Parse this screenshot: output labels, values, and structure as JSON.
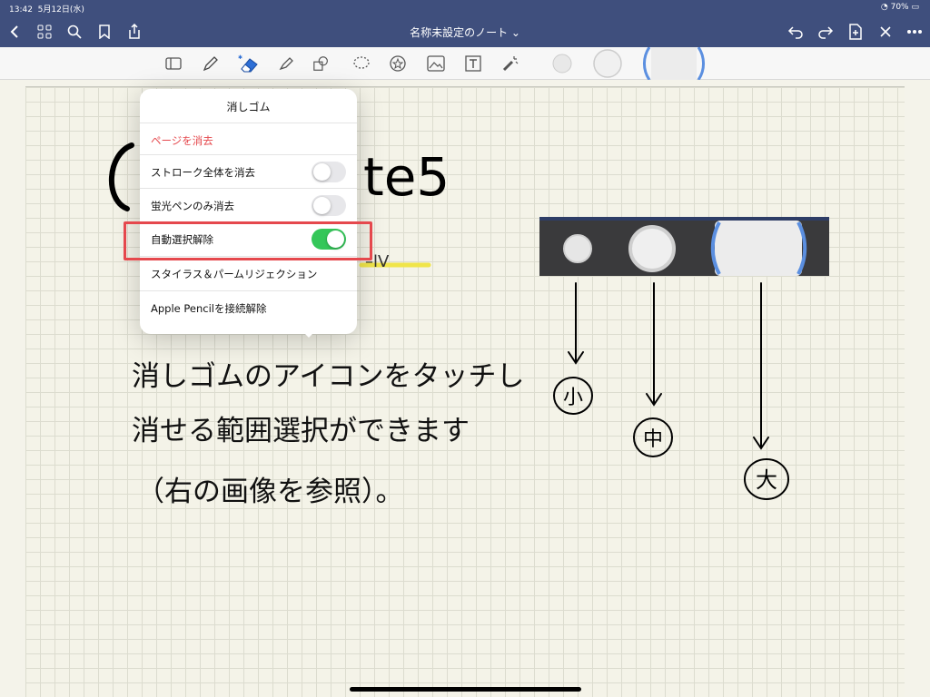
{
  "status": {
    "time": "13:42",
    "date": "5月12日(水)",
    "battery": "70%"
  },
  "nav": {
    "title": "名称未設定のノート ⌄"
  },
  "popover": {
    "title": "消しゴム",
    "erase_page": "ページを消去",
    "rows": [
      {
        "label": "ストローク全体を消去",
        "on": false
      },
      {
        "label": "蛍光ペンのみ消去",
        "on": false
      },
      {
        "label": "自動選択解除",
        "on": true
      },
      {
        "label": "スタイラス＆パームリジェクション"
      },
      {
        "label": "Apple Pencilを接続解除"
      }
    ]
  },
  "handwriting": {
    "title_fragment": "te5",
    "line1": "消しゴムのアイコンをタッチし",
    "line2": "消せる範囲選択ができます",
    "line3": "（右の画像を参照）。",
    "label_small": "小",
    "label_medium": "中",
    "label_large": "大"
  },
  "colors": {
    "accent_nav": "#3f4f7d",
    "toggle_on": "#34c759",
    "highlight": "#e5484d",
    "danger_text": "#e5484d"
  },
  "icons": [
    "back-icon",
    "grid-icon",
    "search-icon",
    "bookmark-icon",
    "share-icon",
    "undo-icon",
    "redo-icon",
    "add-page-icon",
    "close-icon",
    "more-icon"
  ]
}
